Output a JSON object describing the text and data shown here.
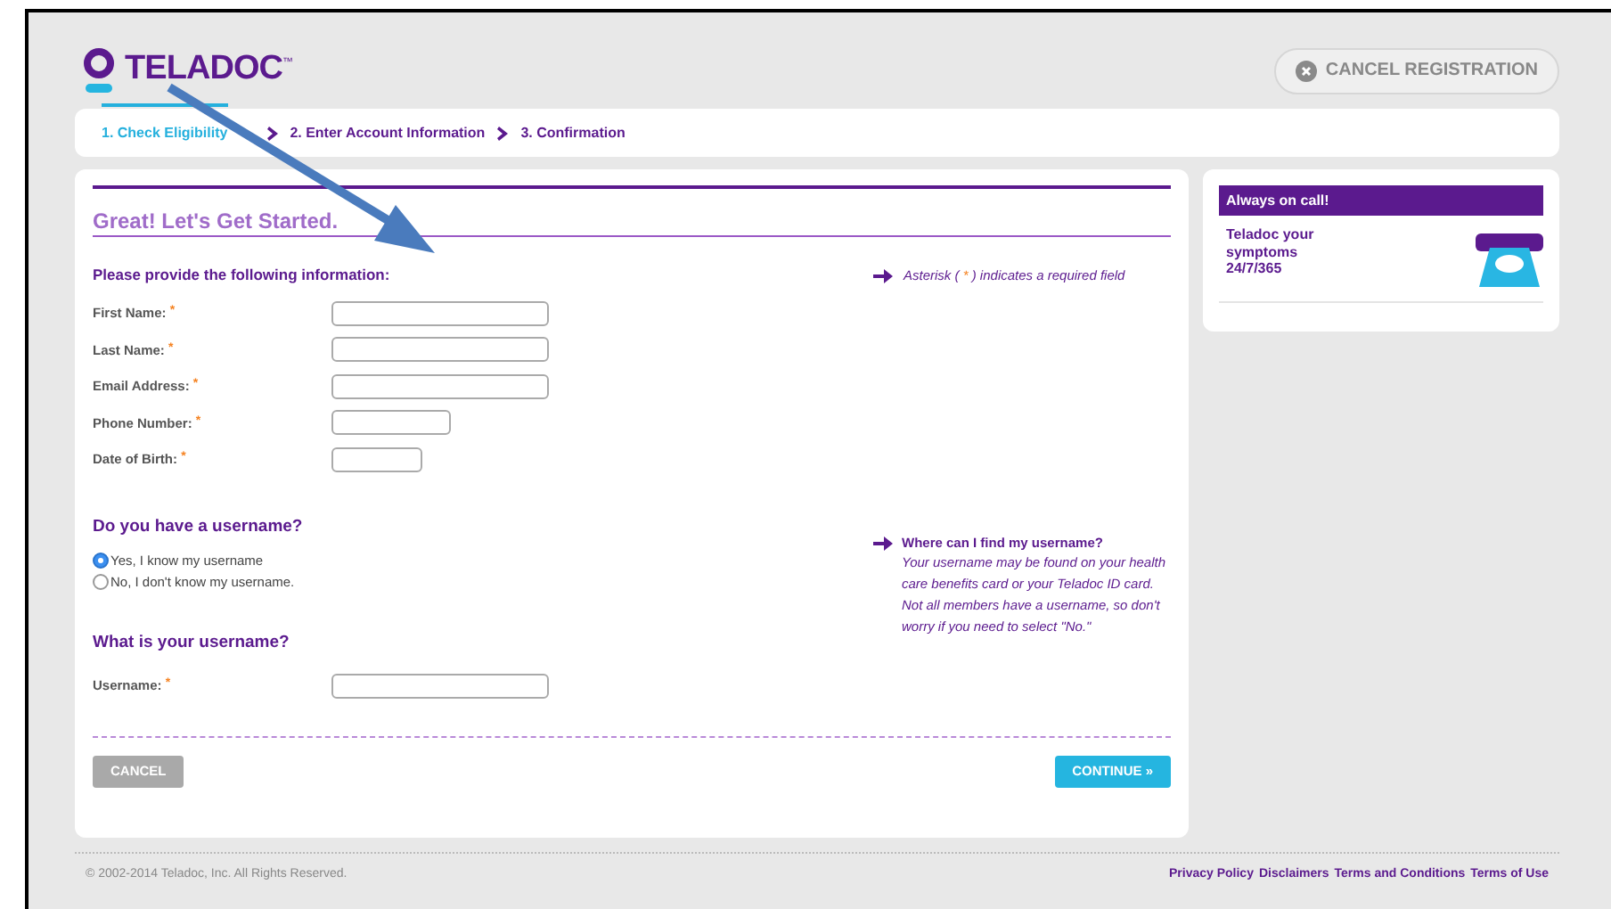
{
  "logo": {
    "text": "TELADOC",
    "mark": "™"
  },
  "cancel_registration": {
    "label": "CANCEL REGISTRATION"
  },
  "steps": [
    {
      "label": "1. Check Eligibility",
      "selected": true
    },
    {
      "label": "2. Enter Account Information",
      "selected": false
    },
    {
      "label": "3. Confirmation",
      "selected": false
    }
  ],
  "form": {
    "heading": "Great! Let's Get Started.",
    "intro": "Please provide the following information:",
    "required_note": {
      "before": "Asterisk (",
      "mark": "*",
      "after": ") indicates a required field"
    },
    "fields": [
      {
        "label": "First Name:",
        "required": true,
        "kind": "wide"
      },
      {
        "label": "Last Name:",
        "required": true,
        "kind": "wide"
      },
      {
        "label": "Email Address:",
        "required": true,
        "kind": "wide"
      },
      {
        "label": "Phone Number:",
        "required": true,
        "kind": "medium"
      },
      {
        "label": "Date of Birth:",
        "required": true,
        "kind": "narrow"
      }
    ],
    "username_question": "Do you have a username?",
    "username_options": [
      {
        "label": "Yes, I know my username",
        "selected": true
      },
      {
        "label": "No, I don't know my username.",
        "selected": false
      }
    ],
    "help": {
      "title": "Where can I find my username?",
      "body": "Your username may be found on your health care benefits card or your Teladoc ID card. Not all members have a username, so don't worry if you need to select \"No.\""
    },
    "username_heading": "What is your username?",
    "username_field": {
      "label": "Username:",
      "required": true,
      "kind": "wide"
    },
    "buttons": [
      {
        "label": "CANCEL",
        "kind": "secondary",
        "disabled": true
      },
      {
        "label": "CONTINUE »",
        "kind": "primary",
        "disabled": false
      }
    ]
  },
  "sidebar": {
    "header": "Always on call!",
    "text_lines": [
      "Teladoc your",
      "symptoms",
      "24/7/365"
    ]
  },
  "footer": {
    "copyright": "© 2002-2014 Teladoc, Inc. All Rights Reserved.",
    "links": [
      "Privacy Policy",
      "Disclaimers",
      "Terms and Conditions",
      "Terms of Use"
    ]
  }
}
